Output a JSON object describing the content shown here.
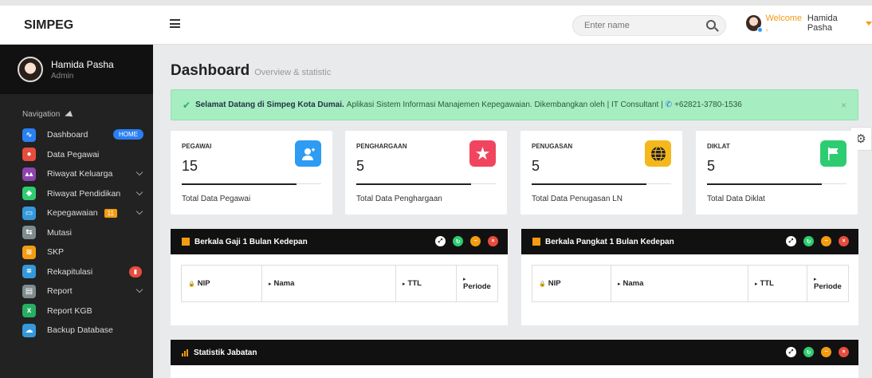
{
  "app": {
    "brand": "SIMPEG"
  },
  "header": {
    "search_placeholder": "Enter name",
    "welcome": "Welcome ,",
    "user_name": "Hamida Pasha"
  },
  "sidebar": {
    "profile_name": "Hamida Pasha",
    "profile_role": "Admin",
    "nav_label": "Navigation",
    "items": [
      {
        "label": "Dashboard",
        "icon": "pulse-icon",
        "color": "#2a7ff2",
        "badge": "HOME"
      },
      {
        "label": "Data Pegawai",
        "icon": "user-icon",
        "color": "#e74c3c"
      },
      {
        "label": "Riwayat Keluarga",
        "icon": "family-icon",
        "color": "#8e44ad"
      },
      {
        "label": "Riwayat Pendidikan",
        "icon": "education-icon",
        "color": "#2ecc71"
      },
      {
        "label": "Kepegawaian",
        "icon": "folder-icon",
        "color": "#3498db",
        "badge": "11"
      },
      {
        "label": "Mutasi",
        "icon": "transfer-icon",
        "color": "#7f8c8d"
      },
      {
        "label": "SKP",
        "icon": "layers-icon",
        "color": "#f39c12"
      },
      {
        "label": "Rekapitulasi",
        "icon": "recap-icon",
        "color": "#3498db"
      },
      {
        "label": "Report",
        "icon": "printer-icon",
        "color": "#7f8c8d"
      },
      {
        "label": "Report KGB",
        "icon": "excel-icon",
        "color": "#27ae60"
      },
      {
        "label": "Backup Database",
        "icon": "cloud-icon",
        "color": "#3498db"
      }
    ]
  },
  "main": {
    "title": "Dashboard",
    "subtitle": "Overview & statistic",
    "alert_bold": "Selamat Datang di Simpeg Kota Dumai.",
    "alert_text": "Aplikasi Sistem Informasi Manajemen Kepegawaian. Dikembangkan oleh | IT Consultant |",
    "alert_phone": "+62821-3780-1536",
    "stats": [
      {
        "label": "PEGAWAI",
        "value": "15",
        "footer": "Total Data Pegawai",
        "icon": "user-add-icon",
        "color": "#2d9cf2"
      },
      {
        "label": "PENGHARGAAN",
        "value": "5",
        "footer": "Total Data Penghargaan",
        "icon": "star-icon",
        "color": "#f0455e"
      },
      {
        "label": "PENUGASAN",
        "value": "5",
        "footer": "Total Data Penugasan LN",
        "icon": "globe-icon",
        "color": "#f5b81c"
      },
      {
        "label": "DIKLAT",
        "value": "5",
        "footer": "Total Data Diklat",
        "icon": "flag-icon",
        "color": "#2ecc71"
      }
    ],
    "panels": {
      "gaji_title": "Berkala Gaji 1 Bulan Kedepan",
      "pangkat_title": "Berkala Pangkat 1 Bulan Kedepan",
      "statistik_title": "Statistik Jabatan"
    },
    "table_headers": {
      "nip": "NIP",
      "nama": "Nama",
      "ttl": "TTL",
      "periode": "Periode"
    }
  }
}
